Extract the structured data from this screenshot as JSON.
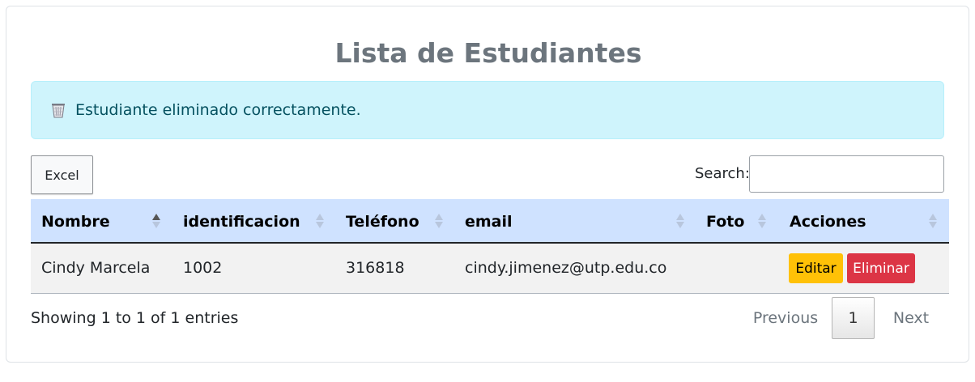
{
  "page": {
    "title": "Lista de Estudiantes"
  },
  "alert": {
    "icon": "trash-icon",
    "message": "Estudiante eliminado correctamente.",
    "background": "#cff4fc",
    "text_color": "#055160"
  },
  "toolbar": {
    "excel_label": "Excel",
    "search_label": "Search:",
    "search_value": ""
  },
  "table": {
    "header_background": "#cfe2ff",
    "columns": [
      {
        "label": "Nombre",
        "sort": "ascending"
      },
      {
        "label": "identificacion",
        "sort": "none"
      },
      {
        "label": "Teléfono",
        "sort": "none"
      },
      {
        "label": "email",
        "sort": "none"
      },
      {
        "label": "Foto",
        "sort": "none"
      },
      {
        "label": "Acciones",
        "sort": "none"
      }
    ],
    "rows": [
      {
        "nombre": "Cindy Marcela",
        "identificacion": "1002",
        "telefono": "316818",
        "email": "cindy.jimenez@utp.edu.co",
        "foto": "",
        "actions": {
          "edit_label": "Editar",
          "delete_label": "Eliminar"
        }
      }
    ]
  },
  "footer": {
    "info": "Showing 1 to 1 of 1 entries",
    "previous_label": "Previous",
    "current_page": "1",
    "next_label": "Next"
  },
  "colors": {
    "edit_button": "#ffc107",
    "delete_button": "#dc3545"
  }
}
